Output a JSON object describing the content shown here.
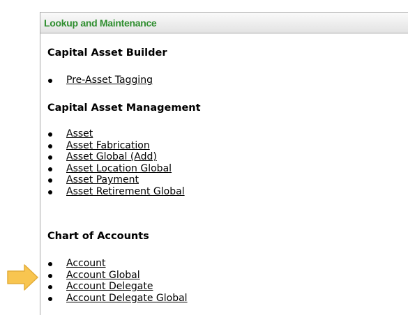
{
  "panel": {
    "title": "Lookup and Maintenance"
  },
  "sections": [
    {
      "title": "Capital Asset Builder",
      "links": [
        "Pre-Asset Tagging"
      ]
    },
    {
      "title": "Capital Asset Management",
      "links": [
        "Asset",
        "Asset Fabrication",
        "Asset Global (Add)",
        "Asset Location Global",
        "Asset Payment",
        "Asset Retirement Global"
      ]
    },
    {
      "title": "Chart of Accounts",
      "links": [
        "Account",
        "Account Global",
        "Account Delegate",
        "Account Delegate Global"
      ]
    }
  ],
  "pointer": {
    "icon": "right-arrow-icon",
    "color": "#f8c550",
    "target": "Account Global"
  },
  "colors": {
    "header_text": "#2f8e2f",
    "border": "#a9a9a9"
  }
}
